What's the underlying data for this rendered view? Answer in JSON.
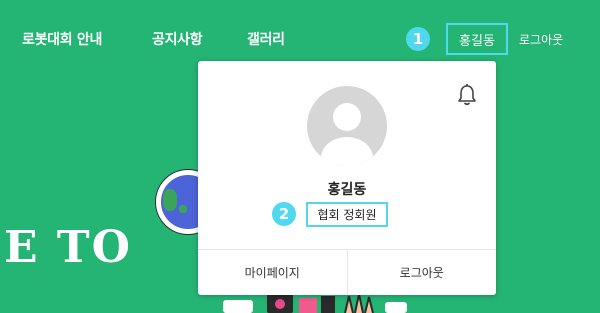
{
  "nav": {
    "items": [
      {
        "label": "로봇대회 안내"
      },
      {
        "label": "공지사항"
      },
      {
        "label": "갤러리"
      }
    ],
    "user_name": "홍길동",
    "logout": "로그아웃"
  },
  "annotations": {
    "step1": "1",
    "step2": "2"
  },
  "hero": {
    "text": "E TO"
  },
  "profile_card": {
    "name": "홍길동",
    "member_grade": "협회 정회원",
    "mypage": "마이페이지",
    "logout": "로그아웃",
    "icons": {
      "notification": "bell-icon",
      "avatar": "user-avatar-placeholder"
    }
  },
  "colors": {
    "background": "#24b574",
    "highlight": "#4fd8ef",
    "card": "#ffffff"
  }
}
